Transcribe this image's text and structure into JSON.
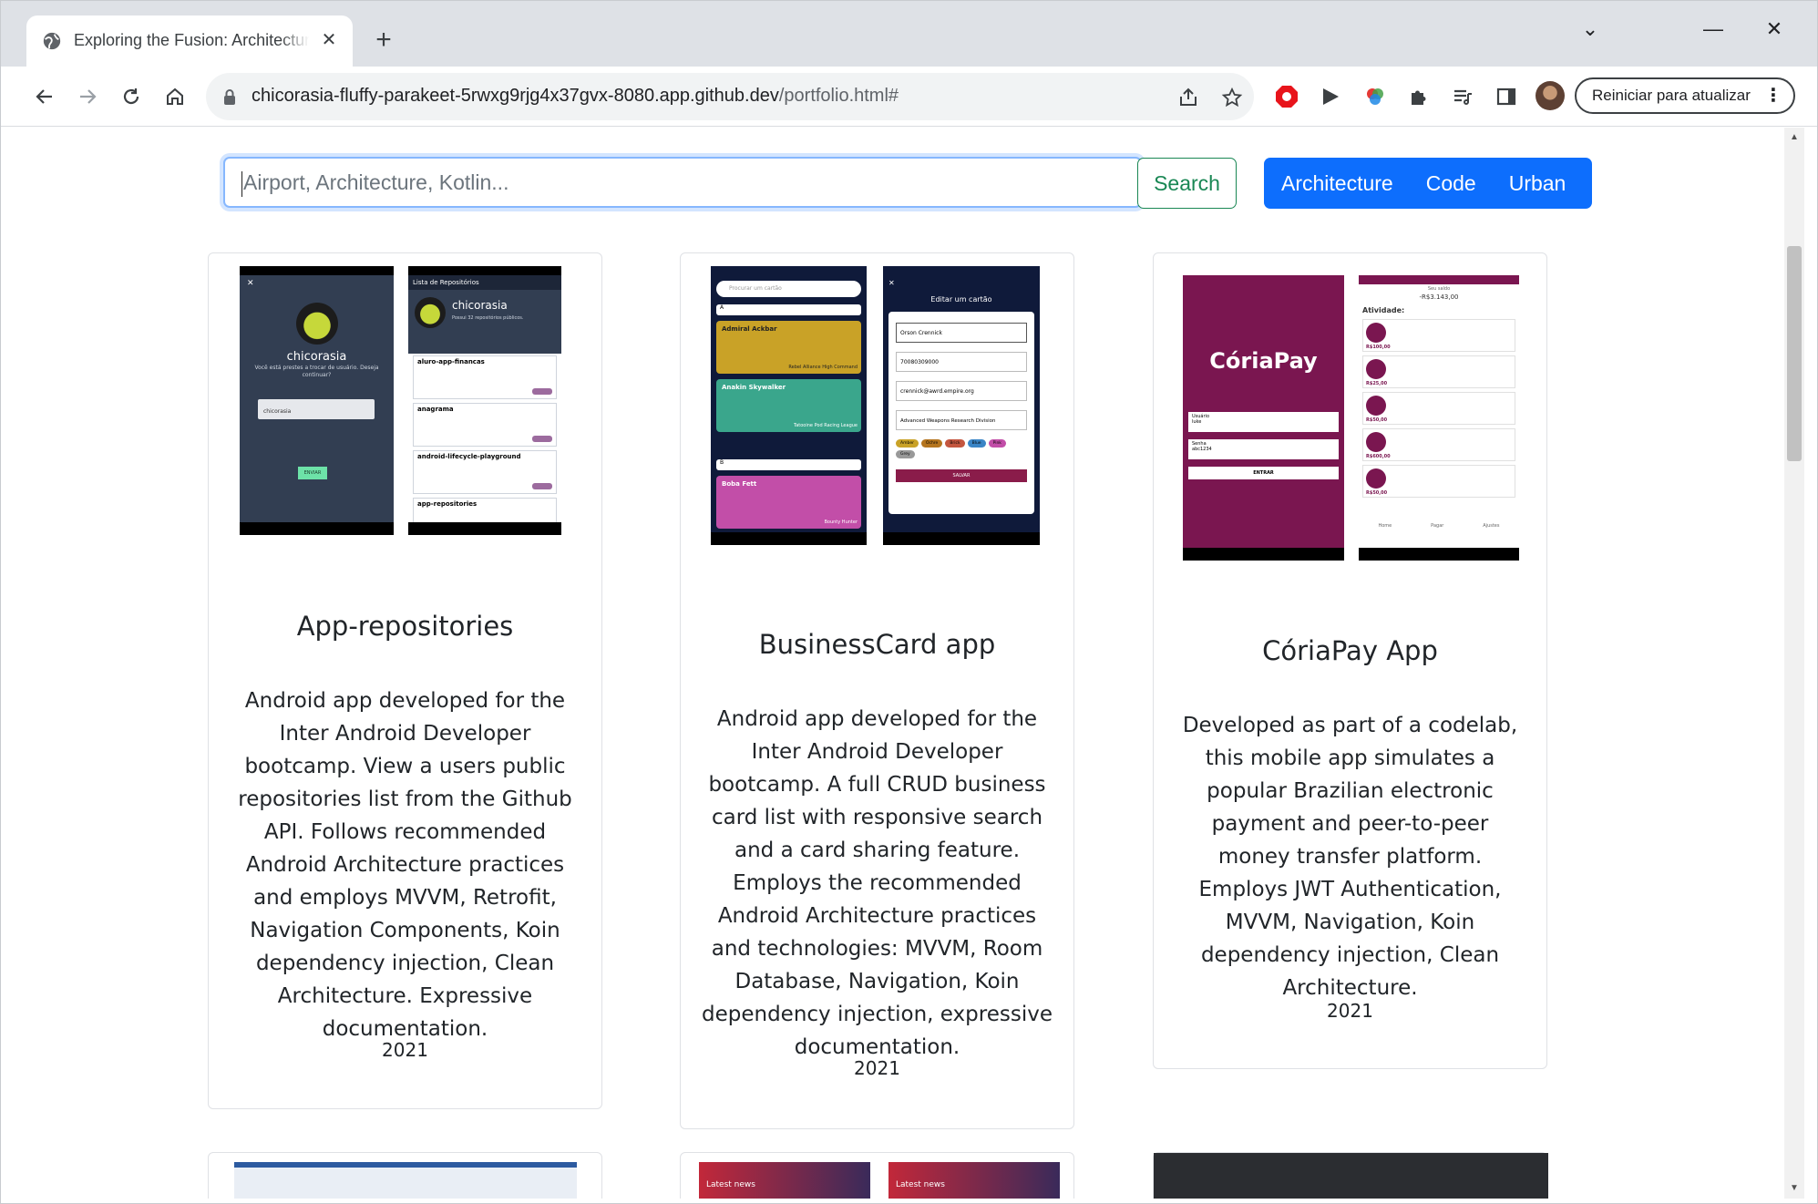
{
  "browser": {
    "tab_title": "Exploring the Fusion: Architecture, Code and Urban",
    "tab_close": "✕",
    "new_tab": "+",
    "window_controls": [
      "⌄",
      "—",
      "☐",
      "✕"
    ],
    "url_host": "chicorasia-fluffy-parakeet-5rwxg9rjg4x37gvx-8080.app.github.dev",
    "url_path": "/portfolio.html#",
    "restart_label": "Reiniciar para atualizar",
    "icons": [
      "back-icon",
      "forward-icon",
      "reload-icon",
      "home-icon",
      "lock-icon",
      "share-icon",
      "star-icon"
    ]
  },
  "search": {
    "placeholder": "Airport, Architecture, Kotlin...",
    "button_label": "Search",
    "tags": [
      "Architecture",
      "Code",
      "Urban"
    ]
  },
  "colors": {
    "primary": "#0d6efd",
    "success": "#198754",
    "focus_border": "#86b7fe"
  },
  "projects": [
    {
      "title": "App-repositories",
      "description": "Android app developed for the Inter Android Developer bootcamp. View a users public repositories list from the Github API. Follows recommended Android Architecture practices and employs MVVM, Retrofit, Navigation Components, Koin dependency injection, Clean Architecture. Expressive documentation.",
      "year": "2021",
      "screens": {
        "login_name": "chicorasia",
        "login_prompt": "Você está prestes a trocar de usuário. Deseja continuar?",
        "login_field": "chicorasia",
        "login_button": "ENVIAR",
        "list_header": "Lista de Repositórios",
        "profile_name": "chicorasia",
        "profile_sub": "Possui 32 repositórios públicos.",
        "repos": [
          "aluro-app-financas",
          "anagrama",
          "android-lifecycle-playground",
          "app-repositories"
        ]
      }
    },
    {
      "title": "BusinessCard app",
      "description": "Android app developed for the Inter Android Developer bootcamp. A full CRUD business card list with responsive search and a card sharing feature. Employs the recommended Android Architecture practices and technologies: MVVM, Room Database, Navigation, Koin dependency injection, expressive documentation.",
      "year": "2021",
      "screens": {
        "search_hint": "Procurar um cartão",
        "cards": [
          {
            "name": "Admiral Ackbar",
            "company": "Rebel Alliance High Command",
            "color": "#c9a227"
          },
          {
            "name": "Anakin Skywalker",
            "company": "Tatooine Pod Racing League",
            "color": "#3aa68c"
          },
          {
            "name": "Boba Fett",
            "company": "Bounty Hunter",
            "color": "#c24ea8"
          }
        ],
        "edit_title": "Editar um cartão",
        "edit_fields": [
          "Orson Crennick",
          "70080309000",
          "crennick@awrd.empire.org",
          "Advanced Weapons Research Division"
        ],
        "chips": [
          "Amber",
          "Ochre",
          "Brick",
          "Blue",
          "Pink",
          "Grey"
        ],
        "save_button": "SALVAR"
      }
    },
    {
      "title": "CóriaPay App",
      "description": "Developed as part of a codelab, this mobile app simulates a popular Brazilian electronic payment and peer-to-peer money transfer platform. Employs JWT Authentication, MVVM, Navigation, Koin dependency injection, Clean Architecture.",
      "year": "2021",
      "screens": {
        "brand": "CóriaPay",
        "user_label": "Usuário",
        "user_value": "luke",
        "pass_label": "Senha",
        "pass_value": "abc1234",
        "login_button": "ENTRAR",
        "balance_label": "Seu saldo",
        "balance": "-R$3.143,00",
        "activity": "Atividade:",
        "tx": [
          "R$100,00",
          "R$25,00",
          "R$50,00",
          "R$600,00",
          "R$50,00"
        ],
        "tabs": [
          "Home",
          "Pagar",
          "Ajustes"
        ]
      }
    }
  ],
  "next_row_labels": [
    "Latest news",
    "Latest news"
  ]
}
